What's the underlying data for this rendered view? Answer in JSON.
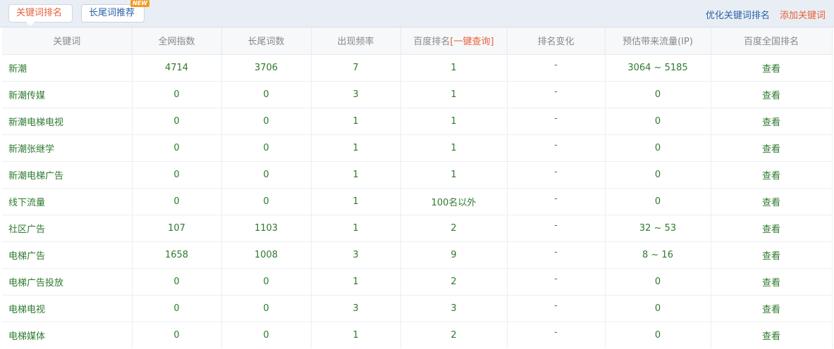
{
  "tabs": {
    "active_label": "关键词排名",
    "second_label": "长尾词推荐",
    "new_badge": "NEW"
  },
  "actions": {
    "optimize_label": "优化关键词排名",
    "add_label": "添加关键词"
  },
  "table": {
    "headers": {
      "keyword": "关键词",
      "index": "全网指数",
      "longtail": "长尾词数",
      "freq": "出现频率",
      "rank_prefix": "百度排名",
      "rank_query": "[一键查询]",
      "change": "排名变化",
      "traffic": "预估带来流量(IP)",
      "national": "百度全国排名"
    },
    "rows": [
      {
        "keyword": "新潮",
        "index": "4714",
        "longtail": "3706",
        "freq": "7",
        "rank": "1",
        "change": "-",
        "traffic": "3064 ~ 5185",
        "view": "查看"
      },
      {
        "keyword": "新潮传媒",
        "index": "0",
        "longtail": "0",
        "freq": "3",
        "rank": "1",
        "change": "-",
        "traffic": "0",
        "view": "查看"
      },
      {
        "keyword": "新潮电梯电视",
        "index": "0",
        "longtail": "0",
        "freq": "1",
        "rank": "1",
        "change": "-",
        "traffic": "0",
        "view": "查看"
      },
      {
        "keyword": "新潮张继学",
        "index": "0",
        "longtail": "0",
        "freq": "1",
        "rank": "1",
        "change": "-",
        "traffic": "0",
        "view": "查看"
      },
      {
        "keyword": "新潮电梯广告",
        "index": "0",
        "longtail": "0",
        "freq": "1",
        "rank": "1",
        "change": "-",
        "traffic": "0",
        "view": "查看"
      },
      {
        "keyword": "线下流量",
        "index": "0",
        "longtail": "0",
        "freq": "1",
        "rank": "100名以外",
        "change": "-",
        "traffic": "0",
        "view": "查看"
      },
      {
        "keyword": "社区广告",
        "index": "107",
        "longtail": "1103",
        "freq": "1",
        "rank": "2",
        "change": "-",
        "traffic": "32 ~ 53",
        "view": "查看"
      },
      {
        "keyword": "电梯广告",
        "index": "1658",
        "longtail": "1008",
        "freq": "3",
        "rank": "9",
        "change": "-",
        "traffic": "8 ~ 16",
        "view": "查看"
      },
      {
        "keyword": "电梯广告投放",
        "index": "0",
        "longtail": "0",
        "freq": "1",
        "rank": "2",
        "change": "-",
        "traffic": "0",
        "view": "查看"
      },
      {
        "keyword": "电梯电视",
        "index": "0",
        "longtail": "0",
        "freq": "3",
        "rank": "3",
        "change": "-",
        "traffic": "0",
        "view": "查看"
      },
      {
        "keyword": "电梯媒体",
        "index": "0",
        "longtail": "0",
        "freq": "1",
        "rank": "2",
        "change": "-",
        "traffic": "0",
        "view": "查看"
      }
    ]
  }
}
